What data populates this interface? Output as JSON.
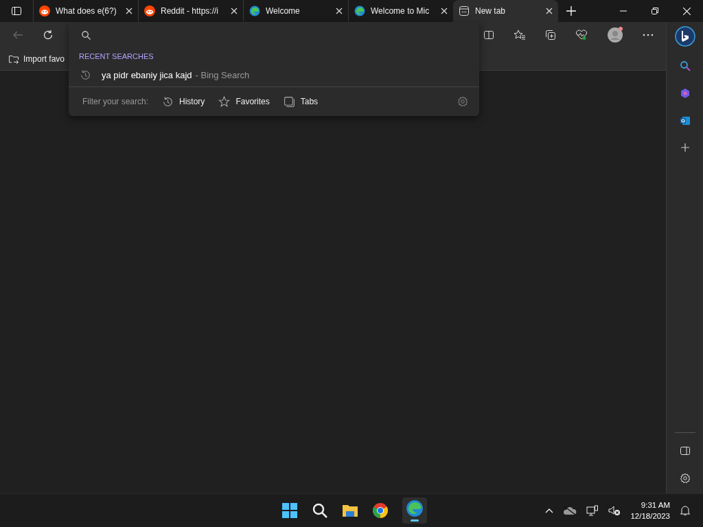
{
  "tabs": [
    {
      "title": "What does e(6?)",
      "kind": "reddit",
      "selected": false
    },
    {
      "title": "Reddit - https://i",
      "kind": "reddit",
      "selected": false
    },
    {
      "title": "Welcome",
      "kind": "edge",
      "selected": false
    },
    {
      "title": "Welcome to Mic",
      "kind": "edge",
      "selected": false
    },
    {
      "title": "New tab",
      "kind": "newtab",
      "selected": true
    }
  ],
  "favorites_bar": {
    "import_label": "Import favo"
  },
  "address_dropdown": {
    "section_title": "RECENT SEARCHES",
    "recent": [
      {
        "query": "ya pidr ebaniy jica kajd",
        "source": "- Bing Search"
      }
    ],
    "filter_label": "Filter your search:",
    "filters": [
      {
        "label": "History",
        "kind": "history"
      },
      {
        "label": "Favorites",
        "kind": "favorites"
      },
      {
        "label": "Tabs",
        "kind": "tabs"
      }
    ]
  },
  "taskbar": {
    "time": "9:31 AM",
    "date": "12/18/2023"
  }
}
